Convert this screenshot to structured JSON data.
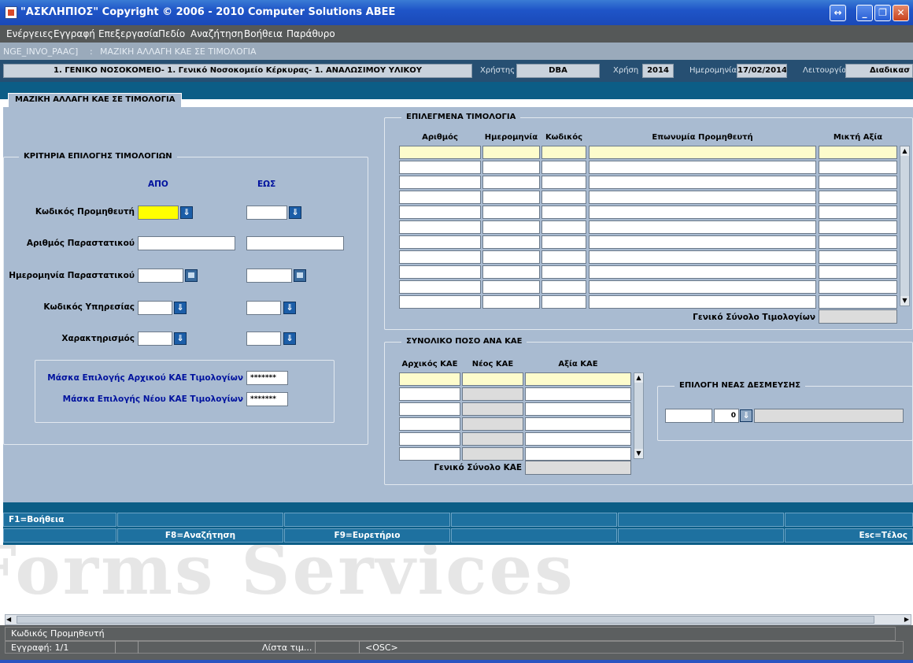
{
  "window": {
    "title": "\"ΑΣΚΛΗΠΙΟΣ\" Copyright © 2006 - 2010 Computer Solutions ΑΒΕΕ"
  },
  "menu": [
    "Ενέργειες",
    "Εγγραφή",
    "Επεξεργασία",
    "Πεδίο",
    "Αναζήτηση",
    "Βοήθεια",
    "Παράθυρο"
  ],
  "form_caption": {
    "code": "NGE_INVO_PAAC]",
    "separator": ":",
    "name": "ΜΑΖΙΚΗ ΑΛΛΑΓΗ ΚΑΕ ΣΕ ΤΙΜΟΛΟΓΙΑ"
  },
  "infobar": {
    "organization": "1. ΓΕΝΙΚΟ ΝΟΣΟΚΟΜΕΙΟ- 1. Γενικό Νοσοκομείο Κέρκυρας- 1. ΑΝΑΛΩΣΙΜΟΥ ΥΛΙΚΟΥ",
    "user_label": "Χρήστης",
    "user": "DBA",
    "year_label": "Χρήση",
    "year": "2014",
    "date_label": "Ημερομηνία",
    "date": "17/02/2014",
    "function_label": "Λειτουργία",
    "function": "Διαδικασ"
  },
  "tab": {
    "label": "ΜΑΖΙΚΗ ΑΛΛΑΓΗ ΚΑΕ ΣΕ ΤΙΜΟΛΟΓΙΑ"
  },
  "criteria": {
    "title": "ΚΡΙΤΗΡΙΑ ΕΠΙΛΟΓΗΣ ΤΙΜΟΛΟΓΙΩΝ",
    "from_header": "ΑΠΟ",
    "to_header": "ΕΩΣ",
    "supplier_code": "Κωδικός Προμηθευτή",
    "document_number": "Αριθμός Παραστατικού",
    "document_date": "Ημερομηνία Παραστατικού",
    "service_code": "Κωδικός Υπηρεσίας",
    "characterization": "Χαρακτηρισμός",
    "mask_original_label": "Μάσκα Επιλογής Αρχικού ΚΑΕ Τιμολογίων",
    "mask_original_value": "*******",
    "mask_new_label": "Μάσκα Επιλογής Νέου ΚΑΕ Τιμολογίων",
    "mask_new_value": "*******"
  },
  "selected_invoices": {
    "title": "ΕΠΙΛΕΓΜΕΝΑ ΤΙΜΟΛΟΓΙΑ",
    "columns": [
      "Αριθμός",
      "Ημερομηνία",
      "Κωδικός",
      "Επωνυμία Προμηθευτή",
      "Μικτή Αξία"
    ],
    "total_label": "Γενικό Σύνολο Τιμολογίων"
  },
  "kae_totals": {
    "title": "ΣΥΝΟΛΙΚΟ ΠΟΣΟ ΑΝΑ ΚΑΕ",
    "columns": [
      "Αρχικός ΚΑΕ",
      "Νέος ΚΑΕ",
      "Αξία ΚΑΕ"
    ],
    "total_label": "Γενικό Σύνολο ΚΑΕ"
  },
  "new_commitment": {
    "title": "ΕΠΙΛΟΓΗ ΝΕΑΣ ΔΕΣΜΕΥΣΗΣ",
    "number_value": "0"
  },
  "keys": {
    "f1": "F1=Βοήθεια",
    "f8": "F8=Αναζήτηση",
    "f9": "F9=Ευρετήριο",
    "esc": "Esc=Τέλος"
  },
  "watermark": "Forms Services",
  "status": {
    "field_hint": "Κωδικός Προμηθευτή",
    "record": "Εγγραφή: 1/1",
    "lov": "Λίστα τιμ...",
    "mode": "<OSC>"
  },
  "colors": {
    "canvas": "#a9bbd1",
    "required_field": "#ffff00",
    "current_row": "#fdfccc",
    "label_blue": "#00129e",
    "keybar": "#0c5d86"
  }
}
